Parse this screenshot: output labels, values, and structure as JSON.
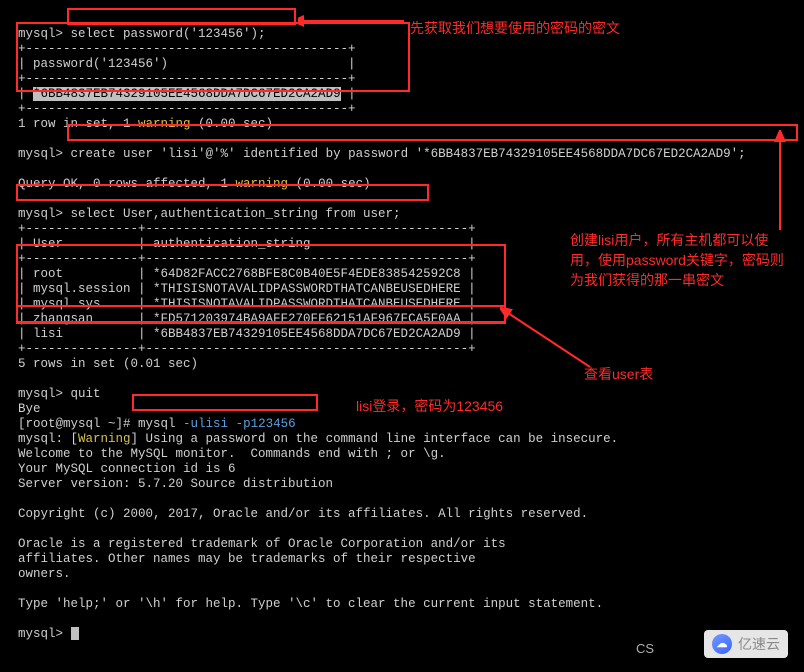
{
  "prompt_mysql": "mysql>",
  "block1": {
    "cmd": "select password('123456');",
    "sep_top": "+-------------------------------------------+",
    "header": "| password('123456')                        |",
    "sep_mid": "+-------------------------------------------+",
    "row": "| ",
    "hash": "*6BB4837EB74329105EE4568DDA7DC67ED2CA2AD9",
    "row_end": " |",
    "sep_bot": "+-------------------------------------------+",
    "result_a": "1 row in set, 1 ",
    "result_warn": "warning",
    "result_b": " (0.00 sec)"
  },
  "block2": {
    "cmd": "create user 'lisi'@'%' identified by password '*6BB4837EB74329105EE4568DDA7DC67ED2CA2AD9';",
    "result_a": "Query OK, 0 rows affected, 1 ",
    "result_warn": "warning",
    "result_b": " (0.00 sec)"
  },
  "block3": {
    "cmd": "mysql> select User,authentication_string from user;",
    "sep": "+---------------+-------------------------------------------+",
    "header": "| User          | authentication_string                     |",
    "rows": [
      "| root          | *64D82FACC2768BFE8C0B40E5F4EDE838542592C8 |",
      "| mysql.session | *THISISNOTAVALIDPASSWORDTHATCANBEUSEDHERE |",
      "| mysql.sys     | *THISISNOTAVALIDPASSWORDTHATCANBEUSEDHERE |",
      "| zhangsan      | *FD571203974BA9AFF270FF62151AF967FCA5F0AA |",
      "| lisi          | *6BB4837EB74329105EE4568DDA7DC67ED2CA2AD9 |"
    ],
    "footer": "5 rows in set (0.01 sec)"
  },
  "block4": {
    "quit": "mysql> quit",
    "bye": "Bye",
    "shell_a": "[root@mysql ~]",
    "shell_b": "# mysql ",
    "opt_u": "-ulisi",
    "opt_p": " -p123456",
    "warn_a": "mysql: [",
    "warn_w": "Warning",
    "warn_b": "] Using a password on the command line interface can be insecure.",
    "welcome": "Welcome to the MySQL monitor.  Commands end with ; or \\g.",
    "connid": "Your MySQL connection id is 6",
    "version": "Server version: 5.7.20 Source distribution",
    "copyright": "Copyright (c) 2000, 2017, Oracle and/or its affiliates. All rights reserved.",
    "oracle1": "Oracle is a registered trademark of Oracle Corporation and/or its",
    "oracle2": "affiliates. Other names may be trademarks of their respective",
    "oracle3": "owners.",
    "help": "Type 'help;' or '\\h' for help. Type '\\c' to clear the current input statement."
  },
  "annotations": {
    "a1": "先获取我们想要使用的密码的密文",
    "a2": "创建lisi用户，所有主机都可以使用，使用password关键字，密码则为我们获得的那一串密文",
    "a3": "查看user表",
    "a4": "lisi登录，密码为123456"
  },
  "watermark": {
    "csdn": "CS",
    "yisu": "亿速云"
  }
}
